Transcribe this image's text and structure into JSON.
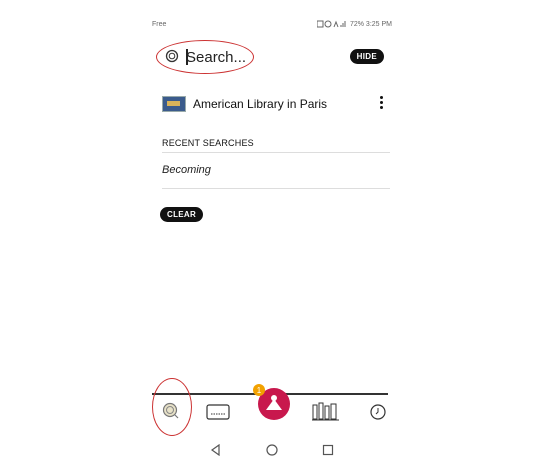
{
  "status_bar": {
    "carrier": "Free",
    "right_text": "72% 3:25 PM"
  },
  "search": {
    "placeholder": "Search...",
    "hide_label": "HIDE"
  },
  "results": [
    {
      "label": "American Library in Paris",
      "icon": "library-card-icon"
    }
  ],
  "recent": {
    "heading": "RECENT SEARCHES",
    "items": [
      "Becoming"
    ],
    "clear_label": "CLEAR"
  },
  "tabbar": {
    "items": [
      {
        "name": "search-tab",
        "icon": "search-icon"
      },
      {
        "name": "library-card-tab",
        "icon": "card-icon"
      },
      {
        "name": "home-tab",
        "icon": "avatar-icon",
        "badge": "1"
      },
      {
        "name": "shelf-tab",
        "icon": "books-icon"
      },
      {
        "name": "history-tab",
        "icon": "clock-icon"
      }
    ]
  },
  "annotations": {
    "highlight_color": "#cc3333"
  }
}
